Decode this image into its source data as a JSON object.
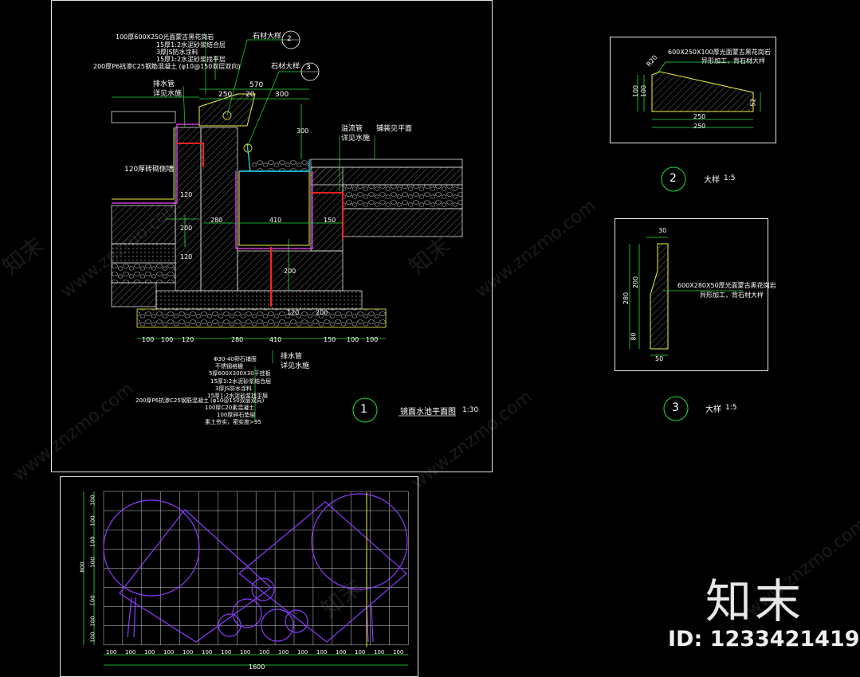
{
  "main_section": {
    "title": "镜面水池平面图",
    "scale": "1:30",
    "badge": "1",
    "top_notes": [
      "100厚600X250光面蒙古黑花岗岩",
      "15厚1:2水泥砂浆结合层",
      "3厚JS防水涂料",
      "15厚1:2水泥砂浆找平层",
      "200厚P6抗渗C25钢筋混凝土 (φ10@150双层双向)"
    ],
    "callout_2": "石材大样",
    "callout_3": "石材大样",
    "left_notes": [
      "排水管",
      "详见水施"
    ],
    "right_notes": [
      "溢流管",
      "详见水施",
      "铺装见平面"
    ],
    "wall_note": "120厚砖砌侧墙",
    "bottom_notes": [
      "Φ30-40卵石铺面",
      "不锈钢格栅",
      "5厚600X300X30干挂板",
      "15厚1:2水泥砂浆结合层",
      "3厚JS防水涂料",
      "15厚1:2水泥砂浆找平层",
      "200厚P6抗渗C25钢筋混凝土 (φ10@150双层双向)",
      "100厚C20素混凝土",
      "100厚碎石垫层",
      "素土夯实，密实度>95"
    ],
    "drain_notes": [
      "排水管",
      "详见水施"
    ],
    "dims_top": [
      "570",
      "250",
      "20",
      "300"
    ],
    "dims_bottom": [
      "100",
      "100",
      "120",
      "280",
      "410",
      "150",
      "100",
      "100"
    ],
    "dims_inner": [
      "120",
      "120",
      "280",
      "410",
      "150",
      "300",
      "200",
      "200",
      "200",
      "120"
    ]
  },
  "detail_2": {
    "badge": "2",
    "title": "大样",
    "scale": "1:5",
    "note": "600X250X100厚光面蒙古黑花岗岩",
    "note2": "异形加工，背石材大样",
    "dims": [
      "R20",
      "100",
      "100",
      "52",
      "250",
      "250"
    ]
  },
  "detail_3": {
    "badge": "3",
    "title": "大样",
    "scale": "1:5",
    "note": "600X280X50厚光面蒙古黑花岗岩",
    "note2": "异形加工，背石材大样",
    "dims": [
      "30",
      "200",
      "280",
      "80",
      "50"
    ]
  },
  "plan_view": {
    "dims_left": [
      "100",
      "100",
      "100",
      "100",
      "800",
      "100",
      "100",
      "100"
    ],
    "dims_bottom": [
      "100",
      "100",
      "100",
      "100",
      "100",
      "100",
      "100",
      "100",
      "100",
      "100",
      "100",
      "100",
      "100",
      "100",
      "100",
      "100"
    ],
    "total": "1600"
  },
  "watermark": {
    "brand": "知末",
    "site": "www.znzmo.com",
    "id_text": "ID: 1233421419"
  },
  "colors": {
    "background": "#000000",
    "frame": "#e6e6e6",
    "green": "#22e03a",
    "yellow": "#f0f040",
    "purple": "#8a3cff",
    "red": "#ff2222",
    "cyan": "#22e5ff",
    "magenta": "#ff44ff",
    "hatch": "#ffffff"
  }
}
